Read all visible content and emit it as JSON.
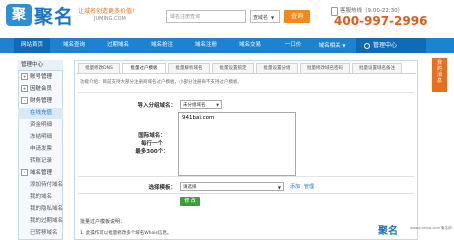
{
  "header": {
    "logo_mark": "聚",
    "logo_name": "聚名",
    "slogan": "让域名创造更多价值!",
    "domain": "JUMING.COM",
    "search_placeholder": "域名注册查询",
    "search_type": "查域名",
    "search_button": "查询",
    "hotline_label": "客服热线（9:00-22:30）",
    "phone": "400-997-2996"
  },
  "nav": {
    "items": [
      "网站首页",
      "域名查询",
      "过期域名",
      "域名抢注",
      "域名注册",
      "域名交易",
      "一口价",
      "域名相关"
    ],
    "active_index": 0,
    "admin_label": "管理中心"
  },
  "sidebar": {
    "title": "管理中心",
    "rows": [
      {
        "type": "group",
        "toggle": "+",
        "label": "账号管理"
      },
      {
        "type": "group",
        "toggle": "+",
        "label": "因赃会员"
      },
      {
        "type": "group",
        "toggle": "-",
        "label": "财务管理"
      },
      {
        "type": "sub",
        "label": "在线充值",
        "active": true
      },
      {
        "type": "sub",
        "label": "资金明细"
      },
      {
        "type": "sub",
        "label": "冻结明细"
      },
      {
        "type": "sub",
        "label": "申请发票"
      },
      {
        "type": "sub",
        "label": "转账记录"
      },
      {
        "type": "group",
        "toggle": "-",
        "label": "域名管理"
      },
      {
        "type": "sub",
        "label": "添加待付域名"
      },
      {
        "type": "sub",
        "label": "我的域名"
      },
      {
        "type": "sub",
        "label": "我的隐私域名"
      },
      {
        "type": "sub",
        "label": "我的过期域名"
      },
      {
        "type": "sub",
        "label": "已转移域名"
      }
    ]
  },
  "tabs": [
    "批量修改DNS",
    "批量过户模板",
    "批量解析域名",
    "批量设置锁定",
    "批量设置分组",
    "批量修改域名密码",
    "批量设置域名备注"
  ],
  "active_tab": 1,
  "form": {
    "hint": "功能介绍：目前支持大部分注册商域名过户模板，小部分注册商不支持过户模板。",
    "group_label": "导入分组域名：",
    "group_value": "未分组域名",
    "domain_label_line1": "国际域名：",
    "domain_label_line2": "每行一个",
    "domain_label_line3": "最多300个：",
    "textarea_value": "941bai.com",
    "template_label": "选择模板：",
    "template_value": "请选择",
    "add_link": "添加",
    "manage_link": "管理",
    "submit_label": "修 改"
  },
  "notes": {
    "title": "批量过户模板说明：",
    "line1": "1. 此操作可以批量修改多个域名Whois信息。"
  },
  "float_button": "我\n的\n消\n息",
  "watermark": {
    "mark": "聚名",
    "text": "www.juming.com 聚名网"
  },
  "colors": {
    "brand_blue": "#1d82cf",
    "accent_orange": "#e05a1b",
    "submit_green": "#3e9e3e"
  }
}
